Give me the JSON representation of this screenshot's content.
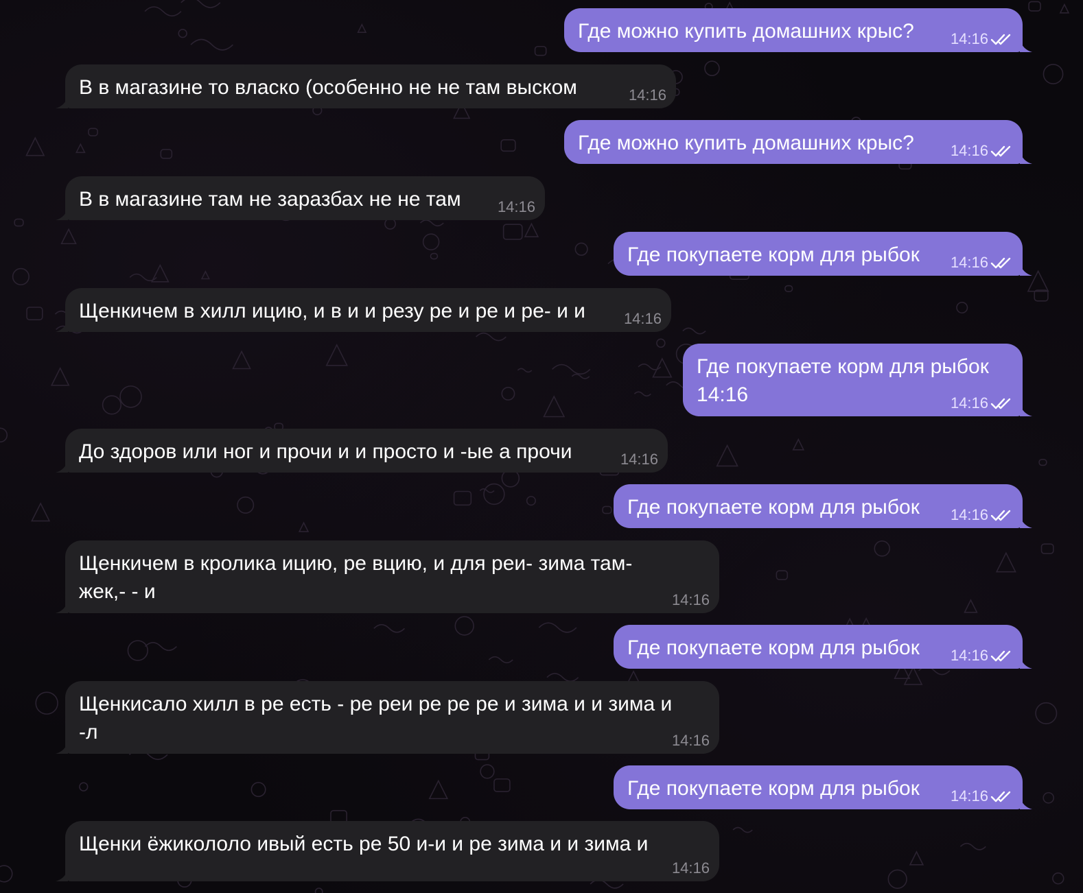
{
  "chat": {
    "colors": {
      "outgoing_bubble": "#8474d8",
      "incoming_bubble": "#222124",
      "background": "#0b090d",
      "text": "#ffffff"
    },
    "messages": [
      {
        "direction": "out",
        "text": "Где можно купить домашних крыс?",
        "time": "14:16",
        "status_icon": "double-check-icon"
      },
      {
        "direction": "in",
        "text": "В в магазине то власко (особенно не не там выском",
        "time": "14:16"
      },
      {
        "direction": "out",
        "text": "Где можно купить домашних крыс?",
        "time": "14:16",
        "status_icon": "double-check-icon"
      },
      {
        "direction": "in",
        "text": "В в магазине там не заразбах не не там",
        "time": "14:16"
      },
      {
        "direction": "out",
        "text": "Где покупаете корм для рыбок",
        "time": "14:16",
        "status_icon": "double-check-icon"
      },
      {
        "direction": "in",
        "text": "Щенкичем в хилл ицию, и в и и резу ре и ре и ре- и и",
        "time": "14:16"
      },
      {
        "direction": "out",
        "text": "Где покупаете корм для рыбок\n14:16",
        "time": "14:16",
        "status_icon": "double-check-icon"
      },
      {
        "direction": "in",
        "text": "До здоров или ног и прочи и и просто и -ые а прочи",
        "time": "14:16"
      },
      {
        "direction": "out",
        "text": "Где покупаете корм для рыбок",
        "time": "14:16",
        "status_icon": "double-check-icon"
      },
      {
        "direction": "in",
        "text": "Щенкичем в кролика ицию, ре вцию, и для реи- зима там-\nжек,- - и",
        "time": "14:16"
      },
      {
        "direction": "out",
        "text": "Где покупаете корм для рыбок",
        "time": "14:16",
        "status_icon": "double-check-icon"
      },
      {
        "direction": "in",
        "text": "Щенкисало хилл в ре есть - ре реи ре ре ре и зима и и зима и\n-л",
        "time": "14:16"
      },
      {
        "direction": "out",
        "text": "Где покупаете корм для рыбок",
        "time": "14:16",
        "status_icon": "double-check-icon"
      },
      {
        "direction": "in",
        "text": "Щенки ёжикололо ивый есть ре 50 и-и и ре зима и и зима и",
        "time": "14:16"
      }
    ]
  }
}
